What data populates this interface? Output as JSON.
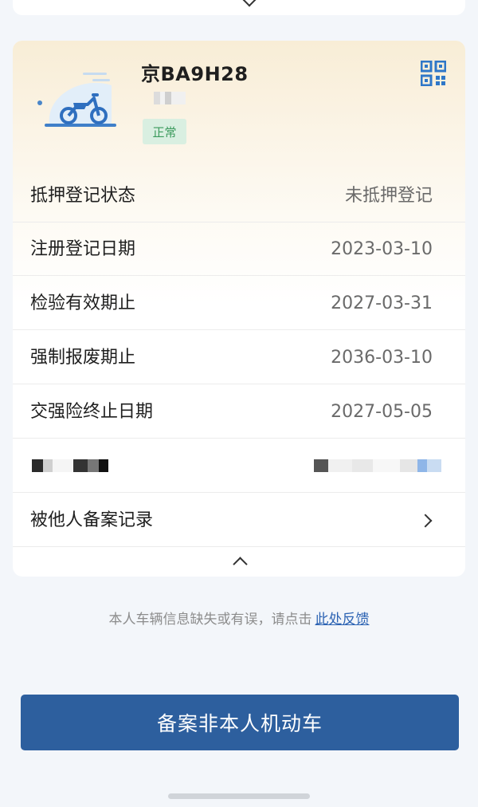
{
  "vehicle": {
    "plate_number": "京BA9H28",
    "status": "正常"
  },
  "details": [
    {
      "label": "抵押登记状态",
      "value": "未抵押登记"
    },
    {
      "label": "注册登记日期",
      "value": "2023-03-10"
    },
    {
      "label": "检验有效期止",
      "value": "2027-03-31"
    },
    {
      "label": "强制报废期止",
      "value": "2036-03-10"
    },
    {
      "label": "交强险终止日期",
      "value": "2027-05-05"
    }
  ],
  "record_link": {
    "label": "被他人备案记录"
  },
  "feedback": {
    "text": "本人车辆信息缺失或有误，请点击",
    "link": "此处反馈"
  },
  "primary_button": {
    "label": "备案非本人机动车"
  },
  "colors": {
    "accent": "#2d5f9e",
    "status_bg": "#d9efe1",
    "status_text": "#3a9a5c",
    "link": "#2c63b3"
  },
  "icons": {
    "vehicle": "motorcycle-icon",
    "qr": "qr-code-icon"
  }
}
